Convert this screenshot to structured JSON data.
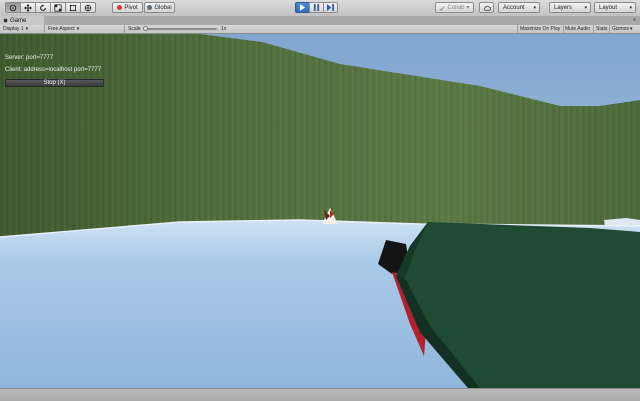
{
  "toolbar": {
    "pivot_label": "Pivot",
    "global_label": "Global",
    "collab_label": "Collab",
    "account_label": "Account",
    "layers_label": "Layers",
    "layout_label": "Layout",
    "caret": "▾",
    "pivot_dot_color": "#d23a3a",
    "global_dot_color": "#5a6a7a"
  },
  "tab": {
    "label": "Game",
    "menu_glyph": "≡"
  },
  "game_view_bar": {
    "display": "Display 1",
    "aspect": "Free Aspect",
    "scale_label": "Scale",
    "scale_value": "1x",
    "scale_fraction": 0.0,
    "maximize_on_play": "Maximize On Play",
    "mute_audio": "Mute Audio",
    "stats": "Stats",
    "gizmos": "Gizmos",
    "caret": "▾"
  },
  "hud": {
    "server_line": "Server: port=7777",
    "client_line": "Client: address=localhost port=7777",
    "stop_button": "Stop (X)"
  },
  "colors": {
    "play_accent": "#2d6bbf",
    "sky": "#8fb3d9",
    "wall": "#4c6a3a",
    "water": "#9ec3e6",
    "boat": "#1f4a33",
    "boat_accent": "#c0303a"
  }
}
